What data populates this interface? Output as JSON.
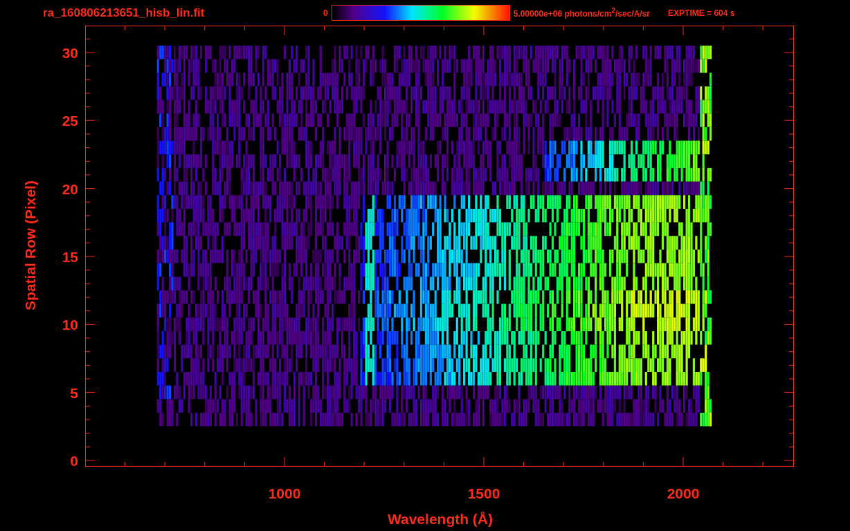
{
  "header": {
    "title": "ra_160806213651_hisb_lin.fit",
    "colorbar_min": "0",
    "colorbar_max": "5.00000e+06 photons/cm$^{2}$/sec/A/sr",
    "exptime": "EXPTIME = 604 s"
  },
  "plot": {
    "x_axis": {
      "label": "Wavelength (Å)",
      "ticks": [
        "1000",
        "1500",
        "2000"
      ]
    },
    "y_axis": {
      "label": "Spatial Row (Pixel)",
      "ticks": [
        "30",
        "25",
        "20",
        "15",
        "10",
        "5",
        "0"
      ]
    }
  }
}
